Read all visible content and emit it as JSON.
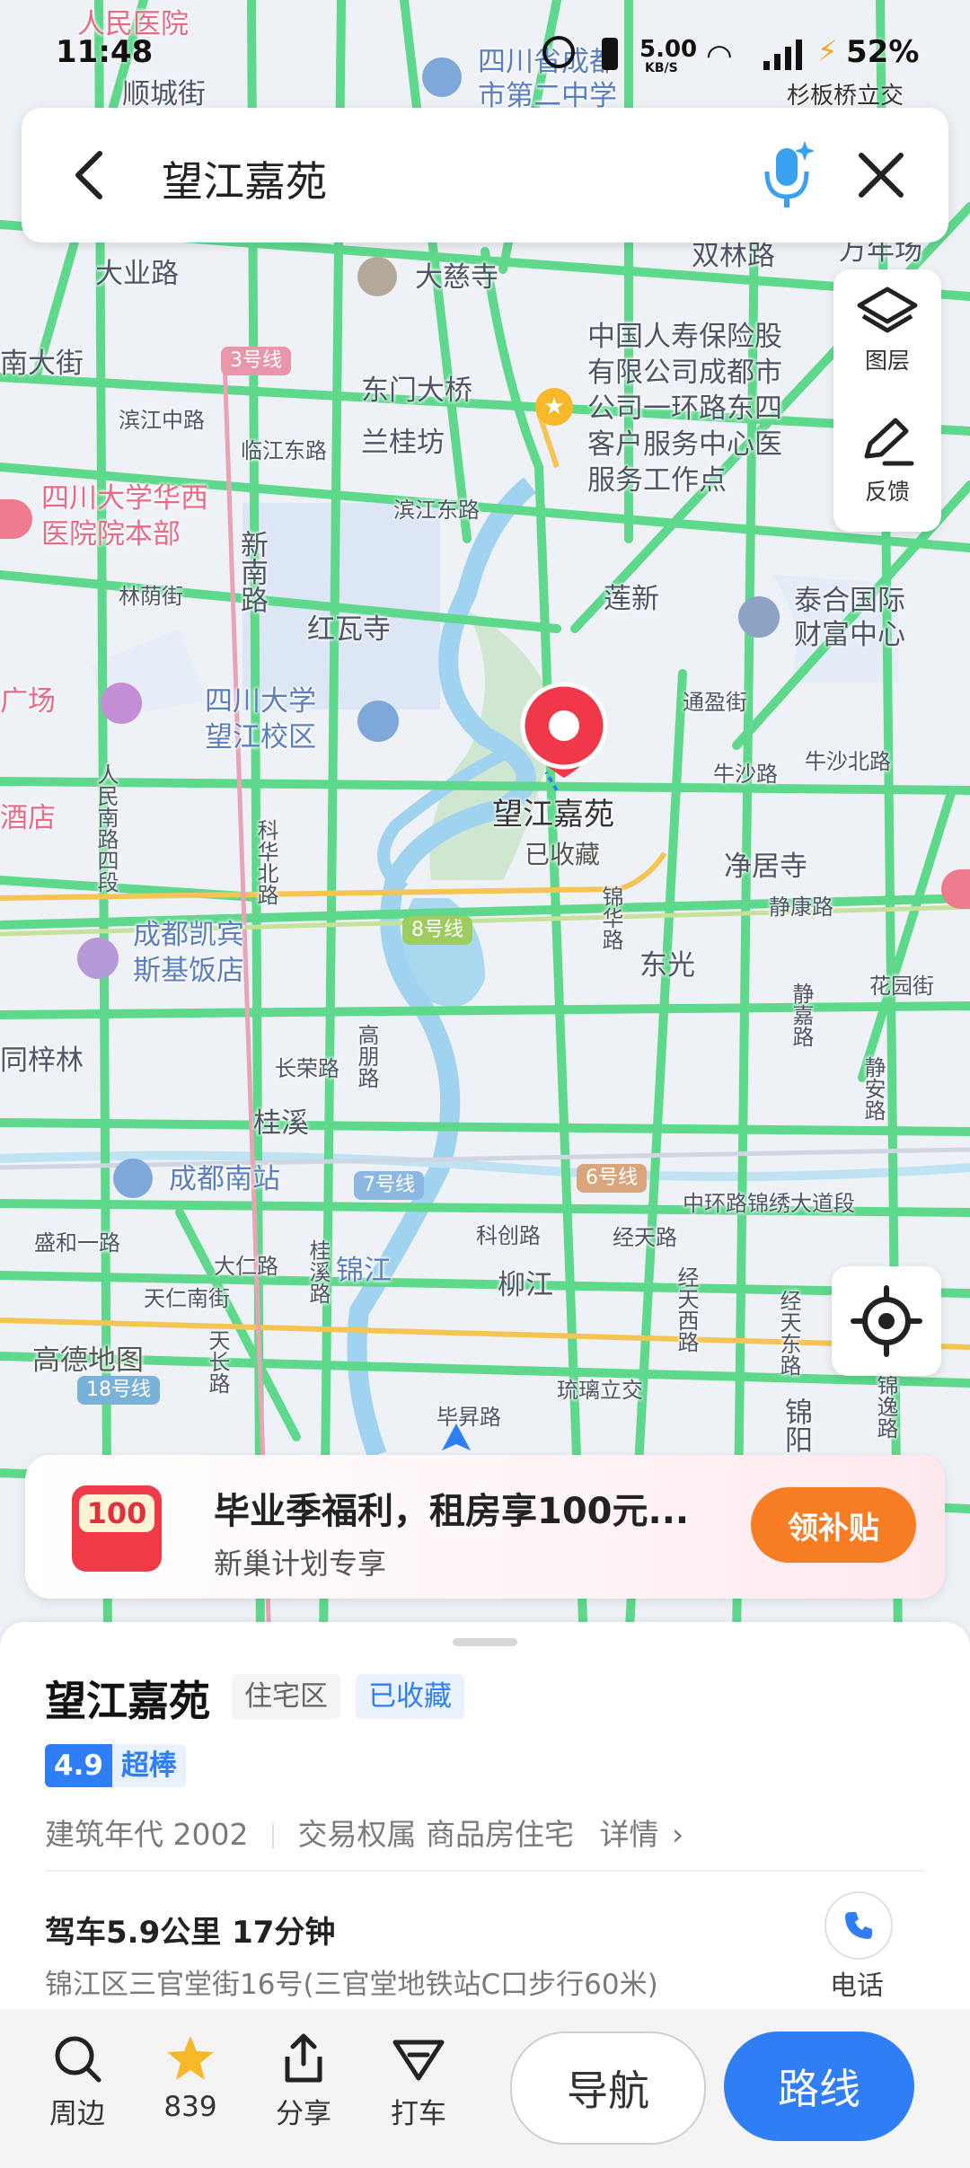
{
  "status_bar": {
    "time": "11:48",
    "net_speed": "5.00",
    "net_unit": "KB/S",
    "battery": "52%",
    "nearby_label": "杉板桥立交"
  },
  "search": {
    "query": "望江嘉苑"
  },
  "map_tools": {
    "layers_label": "图层",
    "feedback_label": "反馈"
  },
  "map_labels": {
    "l1": "人民医院",
    "l2": "顺城街",
    "l3": "四川省成都",
    "l4": "市第二中学",
    "l5": "大业路",
    "l6": "大慈寺",
    "l7": "双林路",
    "l8": "万年场",
    "l9": "南大街",
    "l10": "3号线",
    "l11": "东门大桥",
    "l12": "兰桂坊",
    "l13": "中国人寿保险股",
    "l14": "有限公司成都市",
    "l15": "公司一环路东四",
    "l16": "客户服务中心医",
    "l17": "服务工作点",
    "l18": "滨江中路",
    "l19": "临江东路",
    "l20": "滨江东路",
    "l21": "四川大学华西",
    "l22": "医院院本部",
    "l23": "新南路",
    "l24": "林荫街",
    "l25": "红瓦寺",
    "l26": "莲新",
    "l27": "泰合国际",
    "l28": "财富中心",
    "l29": "广场",
    "l30": "四川大学",
    "l31": "望江校区",
    "l32": "通盈街",
    "l33": "牛沙路",
    "l34": "牛沙北路",
    "l35": "酒店",
    "l36": "科华北路",
    "l37": "人民南路四段",
    "l38": "净居寺",
    "l39": "静康路",
    "l40": "锦华路",
    "l41": "成都凯宾",
    "l42": "斯基饭店",
    "l43": "8号线",
    "l44": "东光",
    "l45": "花园街",
    "l46": "同梓林",
    "l47": "长荣路",
    "l48": "高朋路",
    "l49": "静安路",
    "l50": "桂溪",
    "l51": "成都南站",
    "l52": "7号线",
    "l53": "6号线",
    "l54": "中环路锦绣大道段",
    "l55": "盛和一路",
    "l56": "大仁路",
    "l57": "天仁南街",
    "l58": "桂溪路",
    "l59": "科创路",
    "l60": "经天路",
    "l61": "柳江",
    "l62": "锦江",
    "l63": "经天西路",
    "l64": "经天东路",
    "l65": "高德地图",
    "l66": "18号线",
    "l67": "天长路",
    "l68": "琉璃立交",
    "l69": "毕昇路",
    "l70": "锦阳",
    "l71": "锦逸路",
    "l72": "静嘉路",
    "pin_name": "望江嘉苑",
    "pin_sub": "已收藏"
  },
  "promo": {
    "badge_value": "100",
    "title": "毕业季福利，租房享100元...",
    "subtitle": "新巢计划专享",
    "button": "领补贴"
  },
  "place": {
    "name": "望江嘉苑",
    "type_tag": "住宅区",
    "saved_tag": "已收藏",
    "score": "4.9",
    "score_label": "超棒",
    "built": "建筑年代 2002",
    "ownership": "交易权属 商品房住宅",
    "details": "详情",
    "drive": "驾车5.9公里 17分钟",
    "address": "锦江区三官堂街16号(三官堂地铁站C口步行60米)",
    "phone_label": "电话"
  },
  "toolbar": {
    "nearby": "周边",
    "favorites": "839",
    "share": "分享",
    "taxi": "打车",
    "navigate": "导航",
    "route": "路线"
  },
  "colors": {
    "accent": "#2f7ef6",
    "road_green": "#5ed98c",
    "promo_orange": "#f77d24",
    "pin_red": "#f0384a"
  }
}
